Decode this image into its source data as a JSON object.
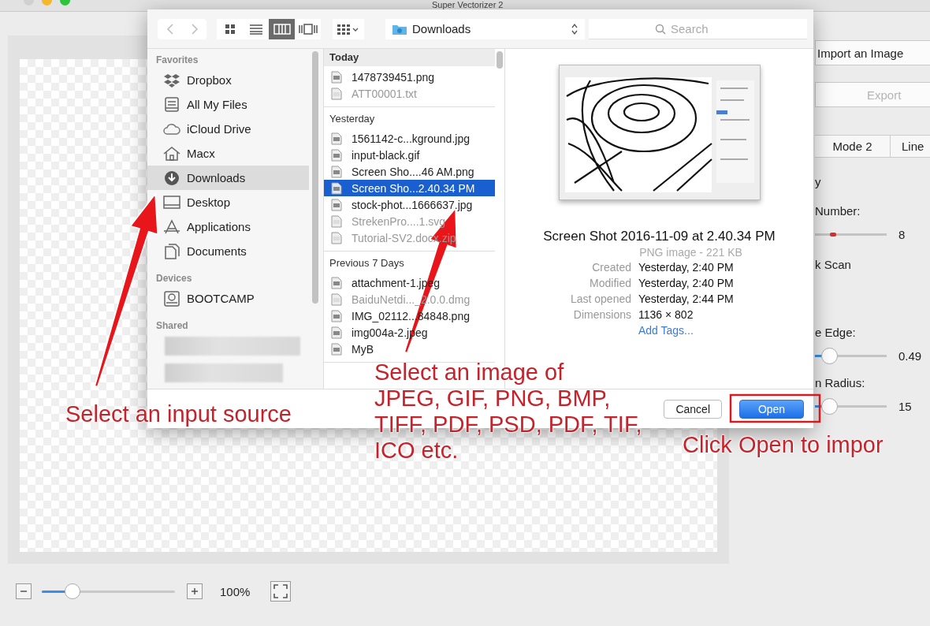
{
  "window": {
    "title": "Super Vectorizer 2"
  },
  "app_panel": {
    "import_button": "Import an Image",
    "export_button": {
      "label": "Export",
      "disabled": true
    },
    "modes": [
      "Mode 2",
      "Line"
    ],
    "params": [
      {
        "kind": "label",
        "label": "y"
      },
      {
        "kind": "label",
        "label": "Number:"
      },
      {
        "kind": "marker",
        "level": 0.25,
        "reading": "8"
      },
      {
        "kind": "label",
        "label": "k Scan"
      },
      {
        "kind": "label",
        "label": "e Edge:"
      },
      {
        "kind": "slider",
        "level": 0.2,
        "reading": "0.49"
      },
      {
        "kind": "label",
        "label": "n Radius:"
      },
      {
        "kind": "slider",
        "level": 0.2,
        "reading": "15"
      }
    ]
  },
  "zoom_bar": {
    "level": 0.23,
    "reading": "100%"
  },
  "dialog": {
    "toolbar": {
      "view_modes": [
        {
          "kind": "icons",
          "selected": false
        },
        {
          "kind": "list",
          "selected": false
        },
        {
          "kind": "columns",
          "selected": true
        },
        {
          "kind": "coverflow",
          "selected": false
        }
      ],
      "location": "Downloads",
      "search": {
        "placeholder": "Search"
      }
    },
    "sidebar": [
      {
        "heading": "Favorites",
        "items": [
          {
            "label": "Dropbox",
            "kind": "dropbox",
            "selected": false
          },
          {
            "label": "All My Files",
            "kind": "files",
            "selected": false
          },
          {
            "label": "iCloud Drive",
            "kind": "cloud",
            "selected": false
          },
          {
            "label": "Macx",
            "kind": "home",
            "selected": false
          },
          {
            "label": "Downloads",
            "kind": "download",
            "selected": true
          },
          {
            "label": "Desktop",
            "kind": "desktop",
            "selected": false
          },
          {
            "label": "Applications",
            "kind": "apps",
            "selected": false
          },
          {
            "label": "Documents",
            "kind": "documents",
            "selected": false
          }
        ]
      },
      {
        "heading": "Devices",
        "items": [
          {
            "label": "BOOTCAMP",
            "kind": "disk",
            "selected": false
          }
        ]
      },
      {
        "heading": "Shared"
      }
    ],
    "file_groups": [
      {
        "heading": "Today",
        "files": [
          {
            "name": "1478739451.png",
            "dimmed": false,
            "selected": false
          },
          {
            "name": "ATT00001.txt",
            "dimmed": true,
            "selected": false
          }
        ]
      },
      {
        "heading": "Yesterday",
        "files": [
          {
            "name": "1561142-c...kground.jpg",
            "dimmed": false,
            "selected": false
          },
          {
            "name": "input-black.gif",
            "dimmed": false,
            "selected": false
          },
          {
            "name": "Screen Sho....46 AM.png",
            "dimmed": false,
            "selected": false
          },
          {
            "name": "Screen Sho...2.40.34 PM",
            "dimmed": false,
            "selected": true
          },
          {
            "name": "stock-phot...1666637.jpg",
            "dimmed": false,
            "selected": false
          },
          {
            "name": "StrekenPro....1.svg",
            "dimmed": true,
            "selected": false
          },
          {
            "name": "Tutorial-SV2.docx.zip",
            "dimmed": true,
            "selected": false
          }
        ]
      },
      {
        "heading": "Previous 7 Days",
        "files": [
          {
            "name": "attachment-1.jpeg",
            "dimmed": false,
            "selected": false
          },
          {
            "name": "BaiduNetdi..._2.0.0.dmg",
            "dimmed": true,
            "selected": false
          },
          {
            "name": "IMG_02112...84848.png",
            "dimmed": false,
            "selected": false
          },
          {
            "name": "img004a-2.jpeg",
            "dimmed": false,
            "selected": false
          },
          {
            "name": "MyB",
            "dimmed": false,
            "selected": false
          }
        ]
      }
    ],
    "preview": {
      "title": "Screen Shot 2016-11-09 at 2.40.34 PM",
      "subtitle": "PNG image - 221 KB",
      "meta": [
        {
          "label": "Created",
          "value": "Yesterday, 2:40 PM"
        },
        {
          "label": "Modified",
          "value": "Yesterday, 2:40 PM"
        },
        {
          "label": "Last opened",
          "value": "Yesterday, 2:44 PM"
        },
        {
          "label": "Dimensions",
          "value": "1136 × 802"
        }
      ],
      "add_tags": "Add Tags..."
    },
    "buttons": [
      {
        "label": "Cancel",
        "default": false
      },
      {
        "label": "Open",
        "default": true
      }
    ]
  },
  "annotations": [
    {
      "text": "Select an input source"
    },
    {
      "text": "Select an image of\nJPEG, GIF, PNG, BMP,\nTIFF, PDF, PSD, PDF, TIF,\nICO etc."
    },
    {
      "text": "Click Open to impor"
    }
  ]
}
